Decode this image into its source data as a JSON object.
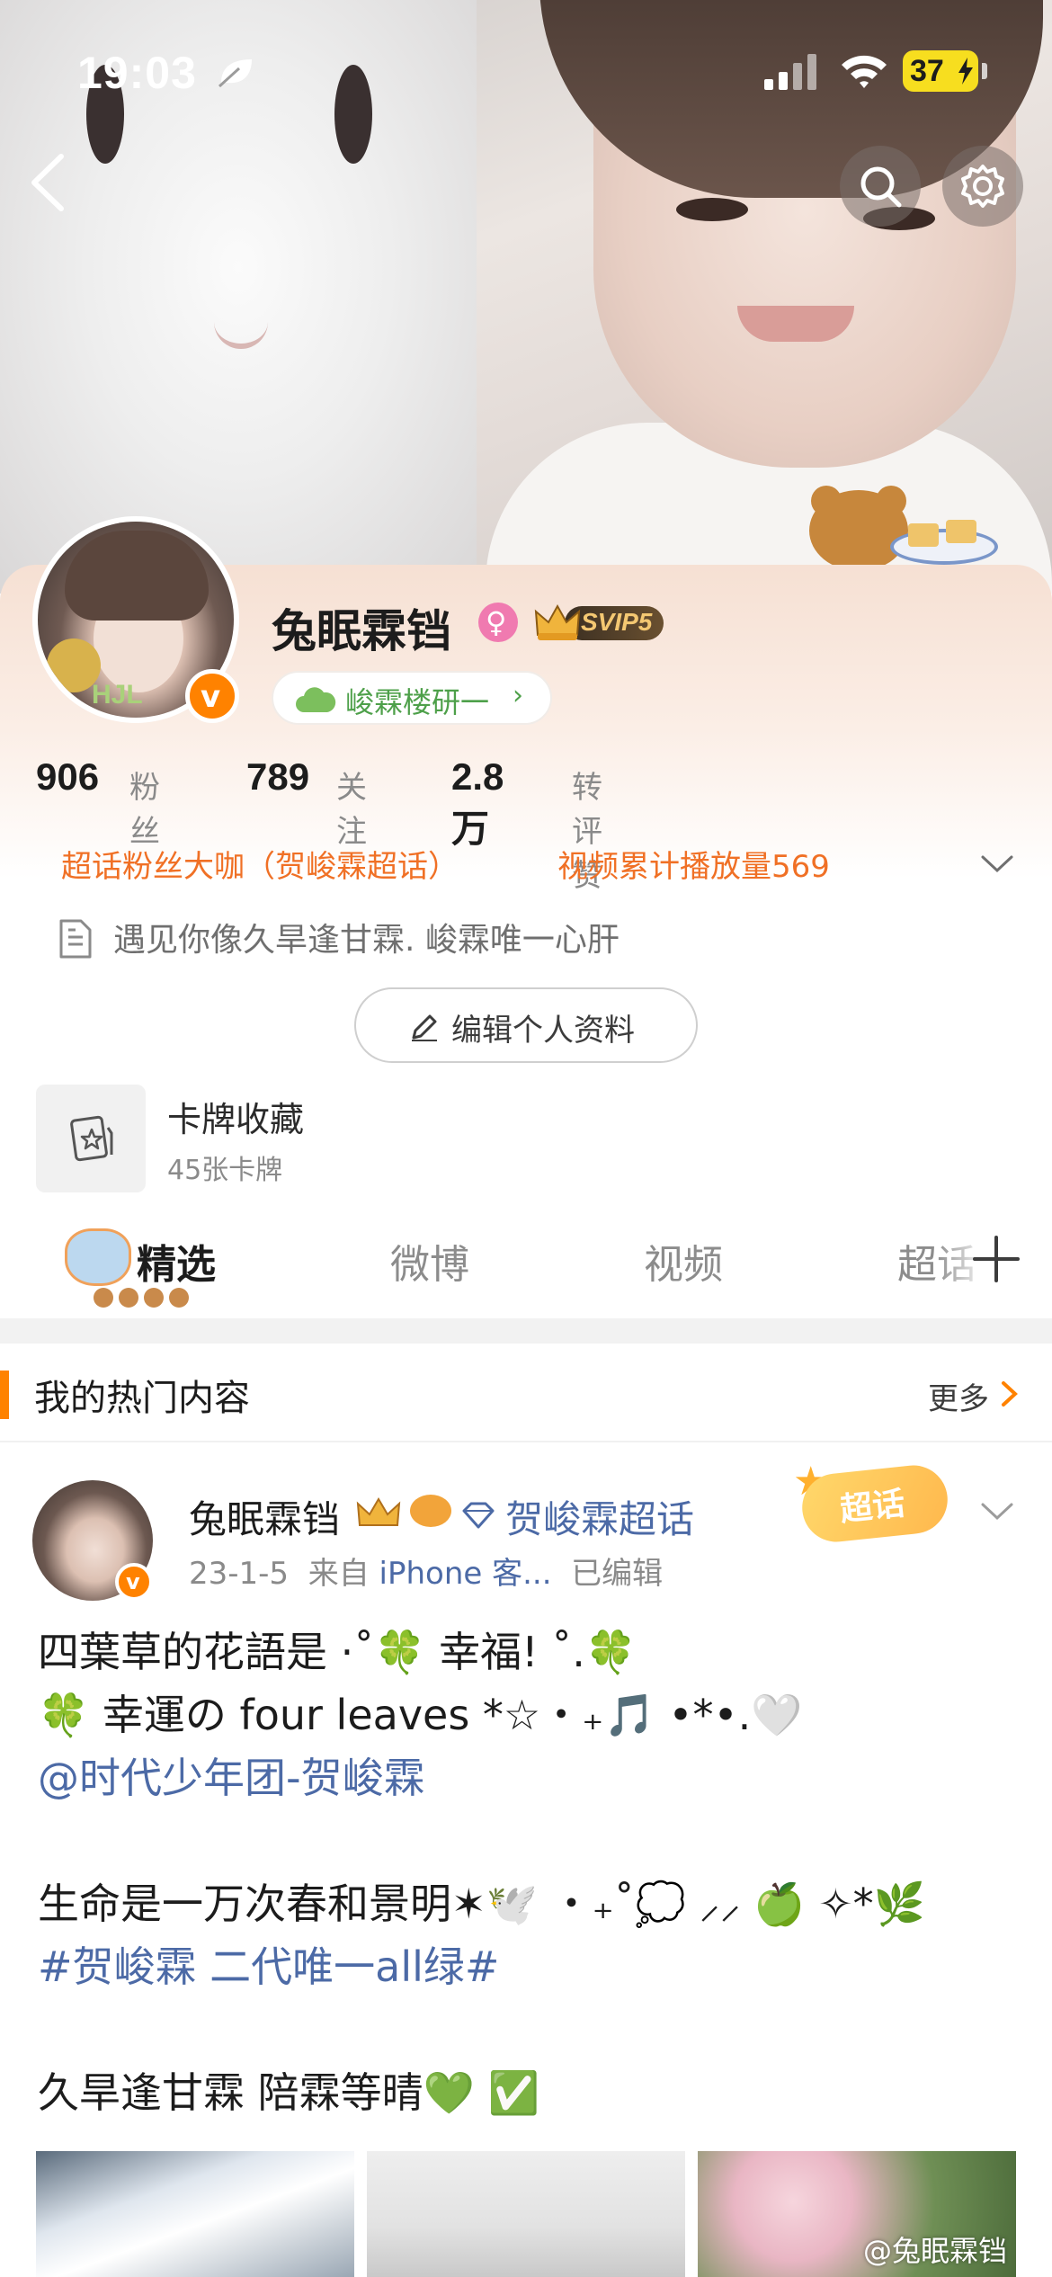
{
  "status_bar": {
    "time": "19:03",
    "battery": "37"
  },
  "profile": {
    "username": "兔眠霖铛",
    "vip_label": "SVIP5",
    "group_label": "峻霖楼研一",
    "stats": [
      {
        "value": "906",
        "label": "粉丝"
      },
      {
        "value": "789",
        "label": "关注"
      },
      {
        "value": "2.8万",
        "label": "转评赞"
      }
    ],
    "tags": [
      "超话粉丝大咖（贺峻霖超话）",
      "视频累计播放量569"
    ],
    "bio": "遇见你像久旱逢甘霖. 峻霖唯一心肝",
    "edit_button": "编辑个人资料",
    "card_collection": {
      "title": "卡牌收藏",
      "subtitle": "45张卡牌"
    },
    "avatar_text": "HJL"
  },
  "tabs": [
    {
      "label": "精选",
      "active": true
    },
    {
      "label": "微博",
      "active": false
    },
    {
      "label": "视频",
      "active": false
    },
    {
      "label": "超话",
      "active": false
    }
  ],
  "hot_section": {
    "title": "我的热门内容",
    "more": "更多"
  },
  "post": {
    "author": "兔眠霖铛",
    "topic": "贺峻霖超话",
    "date": "23-1-5",
    "from_prefix": "来自",
    "source": "iPhone 客...",
    "edited": "已编辑",
    "sticker": "超话",
    "lines": [
      "四葉草的花語是 ·˚🍀 幸福! ˚.🍀",
      "🍀 幸運の four leaves *☆・₊🎵 •*•.🤍",
      "@时代少年团-贺峻霖",
      "",
      "生命是一万次春和景明✶🕊️ ・₊˚💭 ⸝⸝ 🍏 ✧*🌿",
      "#贺峻霖 二代唯一all绿#",
      "",
      "久旱逢甘霖 陪霖等晴💚 ✅"
    ]
  },
  "watermark": "@兔眠霖铛",
  "colors": {
    "accent": "#ff8200",
    "link": "#4c6aa6",
    "tag": "#f07025",
    "group": "#4ea04a"
  }
}
